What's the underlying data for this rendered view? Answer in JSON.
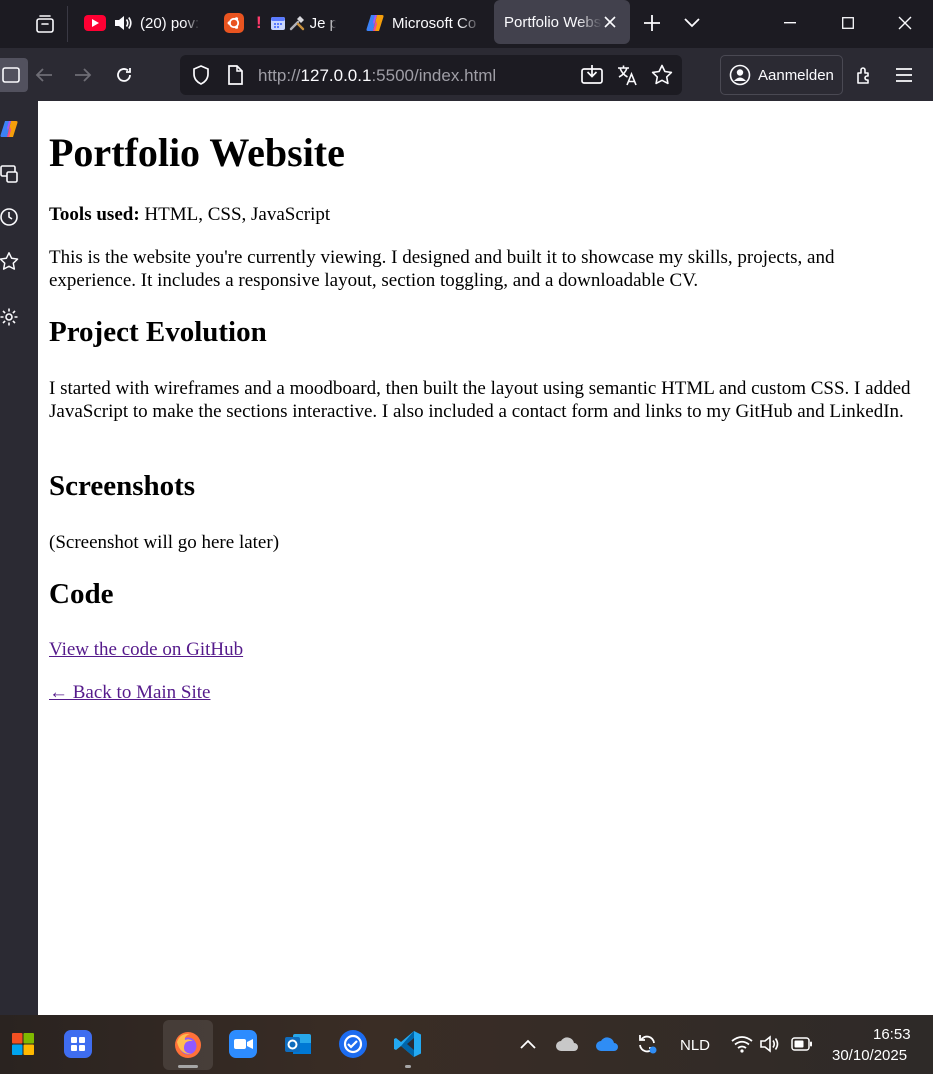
{
  "tabs": [
    {
      "title": "(20) pov:",
      "icon": "youtube-icon",
      "audio": true
    },
    {
      "title": "Je p",
      "icon": "ubuntu-icon",
      "attention": "!"
    },
    {
      "title": "Microsoft Co",
      "icon": "copilot-icon"
    },
    {
      "title": "Portfolio Webs",
      "icon": "page-icon",
      "active": true
    }
  ],
  "nav": {
    "url_scheme": "http://",
    "url_host": "127.0.0.1",
    "url_rest": ":5500/index.html",
    "signin_label": "Aanmelden"
  },
  "page": {
    "title": "Portfolio Website",
    "tools_label": "Tools used:",
    "tools_value": " HTML, CSS, JavaScript",
    "intro": "This is the website you're currently viewing. I designed and built it to showcase my skills, projects, and experience. It includes a responsive layout, section toggling, and a downloadable CV.",
    "evolution_heading": "Project Evolution",
    "evolution_text": "I started with wireframes and a moodboard, then built the layout using semantic HTML and custom CSS. I added JavaScript to make the sections interactive. I also included a contact form and links to my GitHub and LinkedIn.",
    "screenshots_heading": "Screenshots",
    "screenshots_text": "(Screenshot will go here later)",
    "code_heading": "Code",
    "github_link": "View the code on GitHub",
    "back_link": "← Back to Main Site"
  },
  "taskbar": {
    "language": "NLD",
    "time": "16:53",
    "date": "30/10/2025"
  },
  "colors": {
    "link": "#551a8b",
    "chrome_dark": "#1c1b22",
    "chrome_mid": "#2b2a33",
    "active_tab": "#42414d"
  }
}
